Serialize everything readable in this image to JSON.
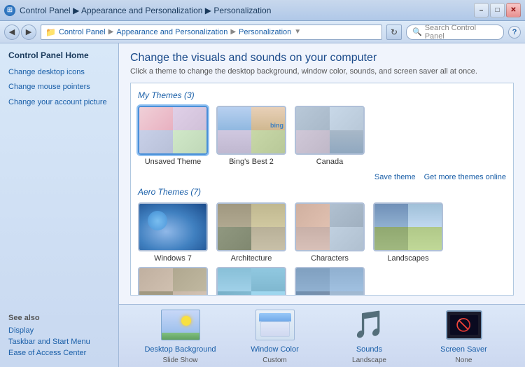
{
  "window": {
    "title": "Personalization",
    "min_btn": "–",
    "max_btn": "□",
    "close_btn": "✕"
  },
  "address_bar": {
    "back_btn": "◀",
    "forward_btn": "▶",
    "breadcrumb": [
      "Control Panel",
      "Appearance and Personalization",
      "Personalization"
    ],
    "refresh_btn": "↻",
    "search_placeholder": "Search Control Panel",
    "help_btn": "?"
  },
  "sidebar": {
    "home_label": "Control Panel Home",
    "links": [
      "Change desktop icons",
      "Change mouse pointers",
      "Change your account picture"
    ],
    "see_also_label": "See also",
    "see_also_links": [
      "Display",
      "Taskbar and Start Menu",
      "Ease of Access Center"
    ]
  },
  "content": {
    "title": "Change the visuals and sounds on your computer",
    "subtitle": "Click a theme to change the desktop background, window color, sounds, and screen saver all at once.",
    "my_themes_label": "My Themes (3)",
    "aero_themes_label": "Aero Themes (7)",
    "save_theme_label": "Save theme",
    "get_more_label": "Get more themes online",
    "themes": {
      "my": [
        {
          "name": "Unsaved Theme",
          "selected": true,
          "type": "unsaved"
        },
        {
          "name": "Bing's Best 2",
          "selected": false,
          "type": "bings"
        },
        {
          "name": "Canada",
          "selected": false,
          "type": "canada"
        }
      ],
      "aero": [
        {
          "name": "Windows 7",
          "selected": false,
          "type": "win7"
        },
        {
          "name": "Architecture",
          "selected": false,
          "type": "arch"
        },
        {
          "name": "Characters",
          "selected": false,
          "type": "chars"
        },
        {
          "name": "Landscapes",
          "selected": false,
          "type": "land"
        }
      ],
      "aero_row2": [
        {
          "name": "",
          "selected": false,
          "type": "row2a"
        },
        {
          "name": "",
          "selected": false,
          "type": "row2b"
        },
        {
          "name": "",
          "selected": false,
          "type": "row2c"
        }
      ]
    }
  },
  "bottom_bar": {
    "items": [
      {
        "label": "Desktop Background",
        "sublabel": "Slide Show"
      },
      {
        "label": "Window Color",
        "sublabel": "Custom"
      },
      {
        "label": "Sounds",
        "sublabel": "Landscape"
      },
      {
        "label": "Screen Saver",
        "sublabel": "None"
      }
    ]
  }
}
